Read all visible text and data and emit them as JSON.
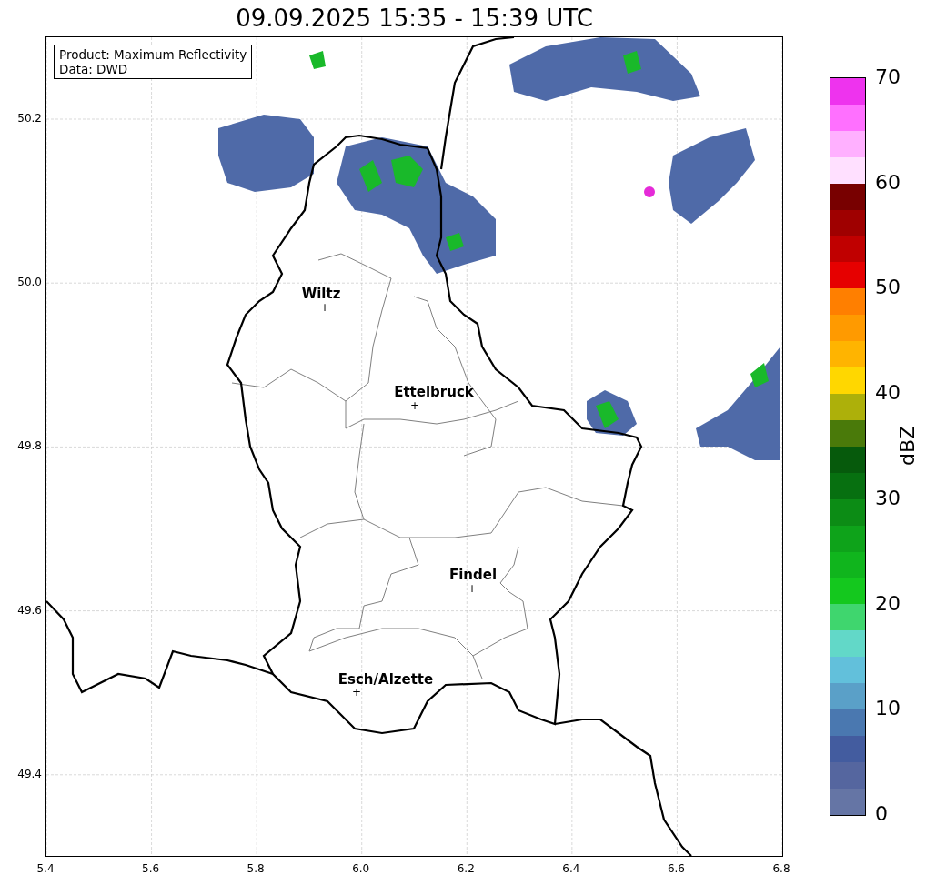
{
  "title": "09.09.2025 15:35 - 15:39 UTC",
  "info_box": {
    "lines": [
      "Product: Maximum Reflectivity",
      "Data: DWD"
    ]
  },
  "map": {
    "cities": [
      {
        "name": "Wiltz",
        "marker": "+"
      },
      {
        "name": "Ettelbruck",
        "marker": "+"
      },
      {
        "name": "Findel",
        "marker": "+"
      },
      {
        "name": "Esch/Alzette",
        "marker": "+"
      }
    ],
    "xticks": [
      "5.4",
      "5.6",
      "5.8",
      "6.0",
      "6.2",
      "6.4",
      "6.6",
      "6.8"
    ],
    "yticks": [
      "50.2",
      "50.0",
      "49.8",
      "49.6",
      "49.4"
    ]
  },
  "colorbar": {
    "label": "dBZ",
    "ticks": [
      "70",
      "60",
      "50",
      "40",
      "30",
      "20",
      "10",
      "0"
    ],
    "bins": [
      {
        "color": "#ee33ee"
      },
      {
        "color": "#ff70ff"
      },
      {
        "color": "#ffb0ff"
      },
      {
        "color": "#ffe0ff"
      },
      {
        "color": "#780000"
      },
      {
        "color": "#9f0000"
      },
      {
        "color": "#c00000"
      },
      {
        "color": "#e60000"
      },
      {
        "color": "#ff7f00"
      },
      {
        "color": "#ff9a00"
      },
      {
        "color": "#ffb400"
      },
      {
        "color": "#ffd700"
      },
      {
        "color": "#adb00a"
      },
      {
        "color": "#4a7a0a"
      },
      {
        "color": "#065a0c"
      },
      {
        "color": "#077010"
      },
      {
        "color": "#0c8c15"
      },
      {
        "color": "#0ea31a"
      },
      {
        "color": "#10b51d"
      },
      {
        "color": "#14c81e"
      },
      {
        "color": "#3fd66e"
      },
      {
        "color": "#62d8c8"
      },
      {
        "color": "#62c0db"
      },
      {
        "color": "#5aa0c8"
      },
      {
        "color": "#4a78b0"
      },
      {
        "color": "#435c9f"
      },
      {
        "color": "#55669f"
      },
      {
        "color": "#6575a5"
      }
    ]
  }
}
